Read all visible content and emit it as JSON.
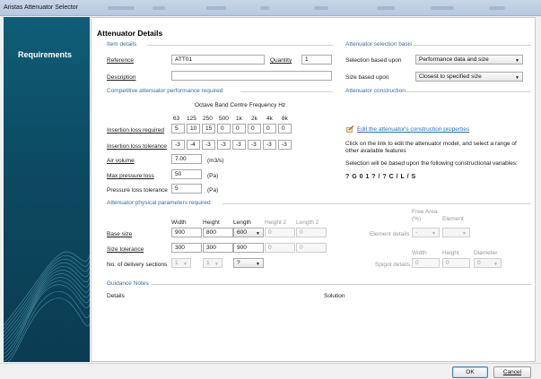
{
  "window": {
    "title": "Aristas Attenuator Selector"
  },
  "sidebar": {
    "label": "Requirements"
  },
  "main": {
    "heading": "Attenuator Details"
  },
  "item_details": {
    "title": "Item details",
    "reference_label": "Reference",
    "reference_value": "ATT01",
    "quantity_label": "Quantity",
    "quantity_value": "1",
    "description_label": "Description",
    "description_value": ""
  },
  "selection_basis": {
    "title": "Attenuator selection basis",
    "based_upon_label": "Selection based upon",
    "based_upon_value": "Performance data and size",
    "size_label": "Size based upon",
    "size_value": "Closest to specified size"
  },
  "performance": {
    "title": "Competitive attenuator performance required",
    "freq_header": "Octave Band Centre Frequency Hz",
    "frequencies": [
      "63",
      "125",
      "250",
      "500",
      "1k",
      "2k",
      "4k",
      "8k"
    ],
    "insertion_loss_label": "Insertion loss required",
    "insertion_loss": [
      "5",
      "10",
      "15",
      "0",
      "0",
      "0",
      "0",
      "0"
    ],
    "tolerance_label": "Insertion loss tolerance",
    "tolerance": [
      "-3",
      "-4",
      "-3",
      "-3",
      "-3",
      "-3",
      "-3",
      "-3"
    ],
    "air_volume_label": "Air volume",
    "air_volume_value": "7.00",
    "air_volume_unit": "(m3/s)",
    "max_pressure_label": "Max pressure loss",
    "max_pressure_value": "50",
    "max_pressure_unit": "(Pa)",
    "pressure_tol_label": "Pressure loss tolerance",
    "pressure_tol_value": "5",
    "pressure_tol_unit": "(Pa)"
  },
  "construction": {
    "title": "Attenuator construction",
    "link": "Edit the attenuator's construction properties",
    "note1": "Click on the link to edit the attenuator model, and select a range of other available features",
    "note2": "Selection will be based upon the following constructional variables:",
    "code": "? G 0 1 ? / ? C / L / S"
  },
  "physical": {
    "title": "Attenuator physical parameters required",
    "col_width": "Width",
    "col_height": "Height",
    "col_length": "Length",
    "col_height2": "Height 2",
    "col_length2": "Length 2",
    "base_label": "Base size",
    "base_width": "900",
    "base_height": "800",
    "base_length": "600",
    "base_height2": "0",
    "base_length2": "0",
    "tol_label": "Size tolerance",
    "tol_width": "300",
    "tol_height": "300",
    "tol_length": "900",
    "tol_height2": "0",
    "tol_length2": "0",
    "sections_label": "No. of delivery sections",
    "sections_a": "1",
    "sections_b": "1",
    "sections_c": "?",
    "free_area_label": "Free Area",
    "free_area_unit": "(%)",
    "element_label": "Element",
    "element_details_label": "Element details",
    "free_area_value": "-",
    "element_value": "",
    "spigot_width_label": "Width",
    "spigot_height_label": "Height",
    "spigot_diameter_label": "Diameter",
    "spigot_label": "Spigot details",
    "spigot_width": "0",
    "spigot_height": "0",
    "spigot_diameter": "0"
  },
  "guidance": {
    "title": "Guidance Notes",
    "details_label": "Details",
    "solution_label": "Solution"
  },
  "buttons": {
    "ok": "OK",
    "cancel": "Cancel"
  }
}
